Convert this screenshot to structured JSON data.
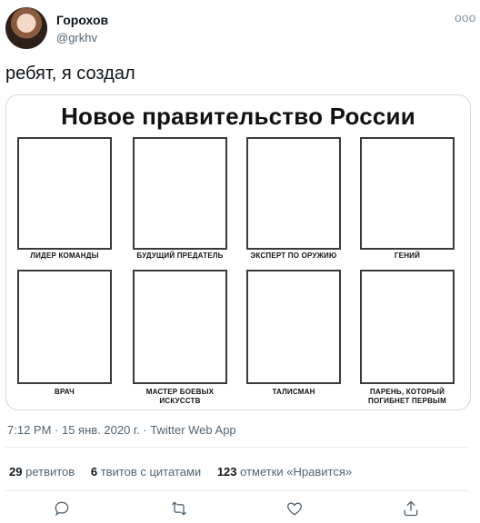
{
  "tweet": {
    "author_name": "Горохов",
    "author_handle": "@grkhv",
    "text": "ребят, я создал",
    "more_icon": "ooo"
  },
  "media": {
    "title": "Новое правительство России",
    "cells": [
      {
        "label": "ЛИДЕР КОМАНДЫ"
      },
      {
        "label": "БУДУЩИЙ ПРЕДАТЕЛЬ"
      },
      {
        "label": "ЭКСПЕРТ ПО ОРУЖИЮ"
      },
      {
        "label": "ГЕНИЙ"
      },
      {
        "label": "ВРАЧ"
      },
      {
        "label": "МАСТЕР БОЕВЫХ ИСКУССТВ"
      },
      {
        "label": "ТАЛИСМАН"
      },
      {
        "label": "ПАРЕНЬ, КОТОРЫЙ ПОГИБНЕТ ПЕРВЫМ"
      }
    ]
  },
  "meta": {
    "time": "7:12 PM",
    "date": "15 янв. 2020 г.",
    "source": "Twitter Web App",
    "text": "7:12 PM · 15 янв. 2020 г. · Twitter Web App"
  },
  "stats": {
    "retweets_count": "29",
    "retweets_label": "ретвитов",
    "quotes_count": "6",
    "quotes_label": "твитов с цитатами",
    "likes_count": "123",
    "likes_label": "отметки «Нравится»"
  },
  "actions": [
    {
      "icon": "reply-icon"
    },
    {
      "icon": "retweet-icon"
    },
    {
      "icon": "like-icon"
    },
    {
      "icon": "share-icon"
    }
  ],
  "colors": {
    "text": "#0f1419",
    "secondary": "#536471",
    "border": "#cfd9de"
  }
}
